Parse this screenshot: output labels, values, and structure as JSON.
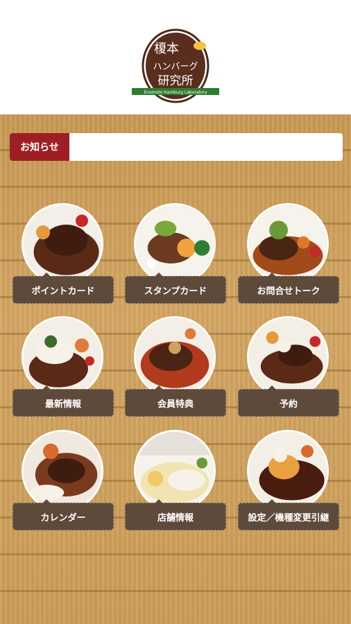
{
  "header": {
    "logo_line1": "榎本",
    "logo_line2": "ハンバーグ",
    "logo_line3": "研究所",
    "logo_ribbon": "Enomoto Hamburg Laboratory"
  },
  "news": {
    "label": "お知らせ",
    "text": ""
  },
  "menu": [
    {
      "label": "ポイントカード"
    },
    {
      "label": "スタンプカード"
    },
    {
      "label": "お問合せトーク"
    },
    {
      "label": "最新情報"
    },
    {
      "label": "会員特典"
    },
    {
      "label": "予約"
    },
    {
      "label": "カレンダー"
    },
    {
      "label": "店舗情報"
    },
    {
      "label": "設定／機種変更引継"
    }
  ],
  "colors": {
    "accent": "#9e1f23",
    "button": "#5e4a3b",
    "wood": "#d4a663"
  }
}
